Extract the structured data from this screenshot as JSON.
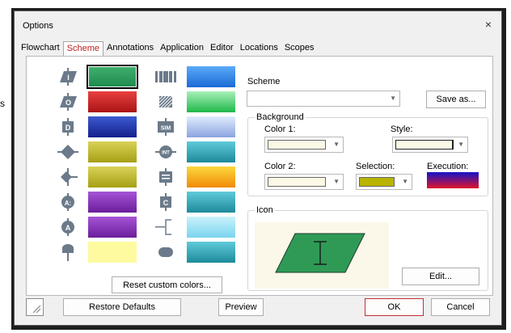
{
  "stray_char": "s",
  "dialog": {
    "title": "Options",
    "close_glyph": "×"
  },
  "tabs": [
    {
      "label": "Flowchart",
      "active": false
    },
    {
      "label": "Scheme",
      "active": true
    },
    {
      "label": "Annotations",
      "active": false
    },
    {
      "label": "Application",
      "active": false
    },
    {
      "label": "Editor",
      "active": false
    },
    {
      "label": "Locations",
      "active": false
    },
    {
      "label": "Scopes",
      "active": false
    }
  ],
  "symbols_left": [
    {
      "icon": "input-parallelogram-icon",
      "glyph": "I"
    },
    {
      "icon": "output-parallelogram-icon",
      "glyph": "O"
    },
    {
      "icon": "declare-icon",
      "glyph": "D"
    },
    {
      "icon": "decision-diamond-icon",
      "glyph": ""
    },
    {
      "icon": "decision-arrow-icon",
      "glyph": ""
    },
    {
      "icon": "assign-circle-icon",
      "glyph": "A:"
    },
    {
      "icon": "call-circle-icon",
      "glyph": "A"
    },
    {
      "icon": "terminal-icon",
      "glyph": ""
    }
  ],
  "symbols_right": [
    {
      "icon": "process-icon",
      "glyph": ""
    },
    {
      "icon": "striped-block-icon",
      "glyph": ""
    },
    {
      "icon": "sim-icon",
      "glyph": "SIM"
    },
    {
      "icon": "int-icon",
      "glyph": "INT"
    },
    {
      "icon": "list-icon",
      "glyph": ""
    },
    {
      "icon": "comment-c-icon",
      "glyph": "C"
    },
    {
      "icon": "bracket-icon",
      "glyph": ""
    },
    {
      "icon": "oval-icon",
      "glyph": ""
    }
  ],
  "colors_left": [
    [
      "#1e8a4e",
      "#40b06e"
    ],
    [
      "#aa1414",
      "#e84040"
    ],
    [
      "#14208c",
      "#3c5ad0"
    ],
    [
      "#a6a014",
      "#d8d258"
    ],
    [
      "#a6a014",
      "#d8d258"
    ],
    [
      "#6a1e9a",
      "#a654d6"
    ],
    [
      "#6a1e9a",
      "#a654d6"
    ],
    [
      "#fdfaa0",
      "#fdfaa0"
    ]
  ],
  "colors_right": [
    [
      "#1a6ad6",
      "#5aaaf8"
    ],
    [
      "#1fb84a",
      "#a8f0b8"
    ],
    [
      "#8aa4e0",
      "#e0ecfc"
    ],
    [
      "#1d8a9a",
      "#5fcada"
    ],
    [
      "#f08a08",
      "#fcd83c"
    ],
    [
      "#1d8a9a",
      "#5fcada"
    ],
    [
      "#7ad4ee",
      "#c8f2fc"
    ],
    [
      "#1d8a9a",
      "#5fcada"
    ]
  ],
  "selected_swatch_index": 0,
  "buttons": {
    "reset_colors": "Reset custom colors...",
    "save_as": "Save as...",
    "edit": "Edit...",
    "restore": "Restore Defaults",
    "preview": "Preview",
    "ok": "OK",
    "cancel": "Cancel"
  },
  "scheme": {
    "label": "Scheme",
    "value": ""
  },
  "background": {
    "title": "Background",
    "color1_label": "Color 1:",
    "color1_value": "#fcf8e6",
    "style_label": "Style:",
    "style_value": "#fcf8e6",
    "color2_label": "Color 2:",
    "color2_value": "#fcf8e6",
    "selection_label": "Selection:",
    "selection_value": "#b8b400",
    "execution_label": "Execution:",
    "execution_colors": [
      "#1414c8",
      "#e01428"
    ]
  },
  "icon_group": {
    "title": "Icon",
    "preview_glyph": "I",
    "preview_fill": "#2f9a56",
    "preview_bg": "#fbf8ea"
  }
}
